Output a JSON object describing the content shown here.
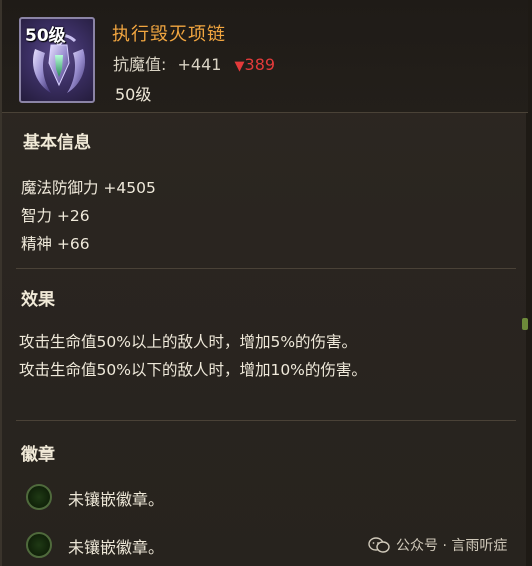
{
  "item": {
    "level_badge": "50级",
    "name": "执行毁灭项链",
    "primary_stat_label": "抗魔值:",
    "primary_stat_value": "+441",
    "compare_arrow": "▼",
    "compare_value": "389",
    "required_level": "50级",
    "icon": "necklace-icon"
  },
  "basic_info": {
    "title": "基本信息",
    "lines": [
      "魔法防御力 +4505",
      "智力 +26",
      "精神 +66"
    ]
  },
  "effect": {
    "title": "效果",
    "lines": [
      "攻击生命值50%以上的敌人时，增加5%的伤害。",
      "攻击生命值50%以下的敌人时，增加10%的伤害。"
    ]
  },
  "emblem": {
    "title": "徽章",
    "slots": [
      "未镶嵌徽章。",
      "未镶嵌徽章。"
    ]
  },
  "watermark": {
    "text": "公众号 · 言雨听症",
    "icon": "wechat-icon"
  },
  "colors": {
    "item_name": "#f2a640",
    "compare_down": "#e33a3a",
    "socket": "#1f3a15"
  }
}
